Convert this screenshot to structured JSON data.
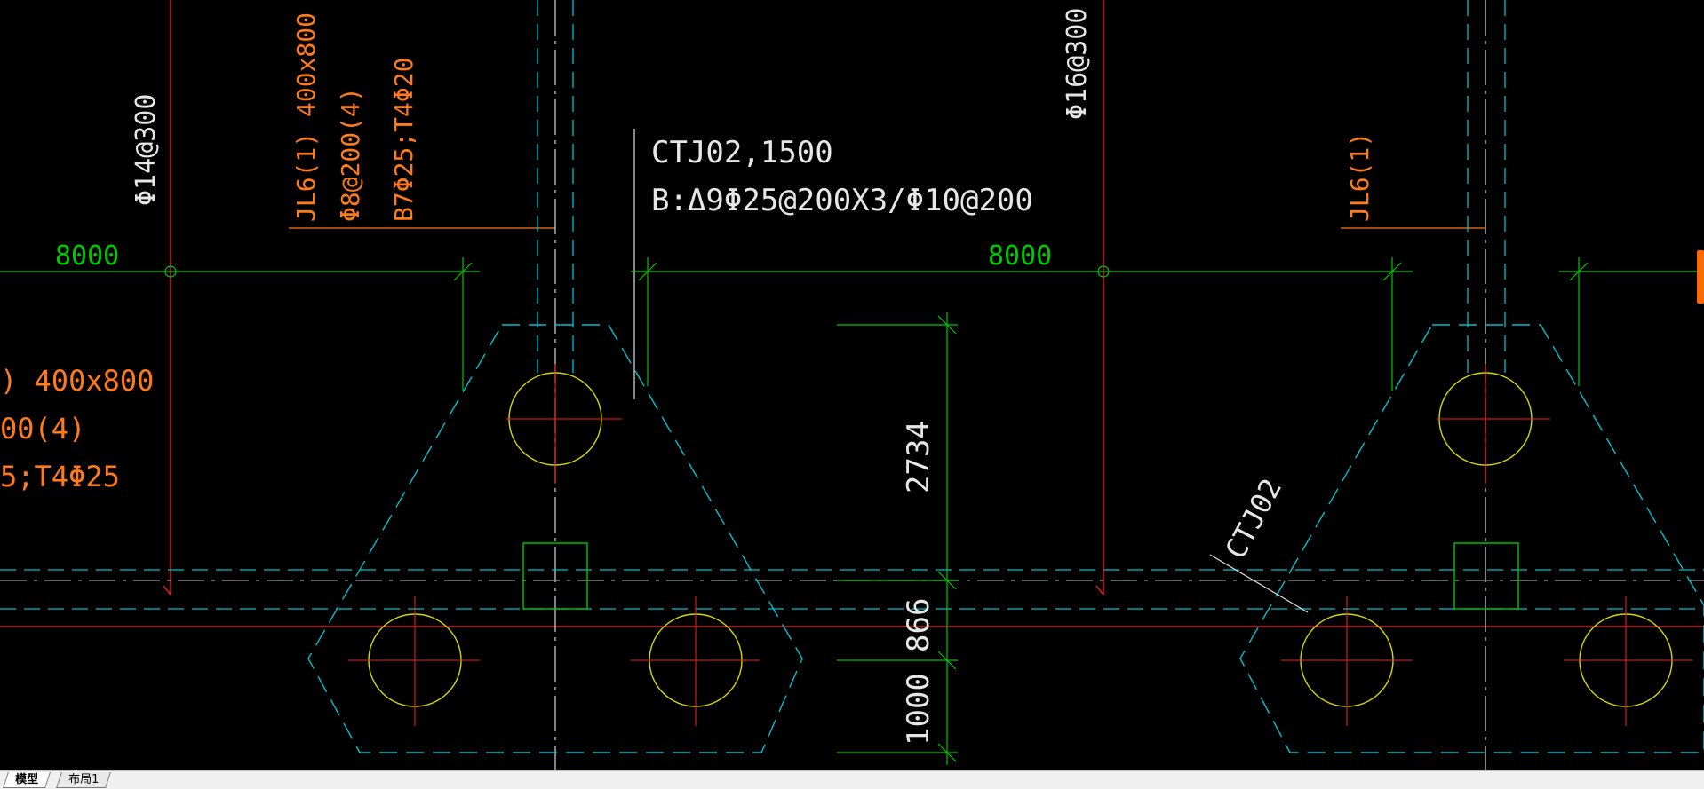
{
  "tabs": [
    {
      "label": "模型",
      "active": true
    },
    {
      "label": "布局1",
      "active": false
    }
  ],
  "dimensions": {
    "span_left": "8000",
    "span_right": "8000",
    "dim_2734": "2734",
    "dim_866": "866",
    "dim_1000": "1000"
  },
  "annotations": {
    "rebar_left": "Φ14@300",
    "rebar_right": "Φ16@300",
    "beam_left_line1": "JL6(1) 400x800",
    "beam_left_line2": "Φ8@200(4)",
    "beam_left_line3": "B7Φ25;T4Φ20",
    "beam_partial_line1": ") 400x800",
    "beam_partial_line2": "00(4)",
    "beam_partial_line3": "5;T4Φ25",
    "beam_right": "JL6(1)",
    "cap_title": "CTJ02,1500",
    "cap_detail": "B:Δ9Φ25@200X3/Φ10@200",
    "cap_label": "CTJ02"
  },
  "colors": {
    "background": "#000000",
    "dim_green": "#00c800",
    "axis_red": "#ff2020",
    "outline_cyan": "#00c0d0",
    "pile_yellow": "#d8d800",
    "beam_orange": "#ff7a1a",
    "text_white": "#e6e6e6",
    "grey_line": "#8a8a8a"
  }
}
